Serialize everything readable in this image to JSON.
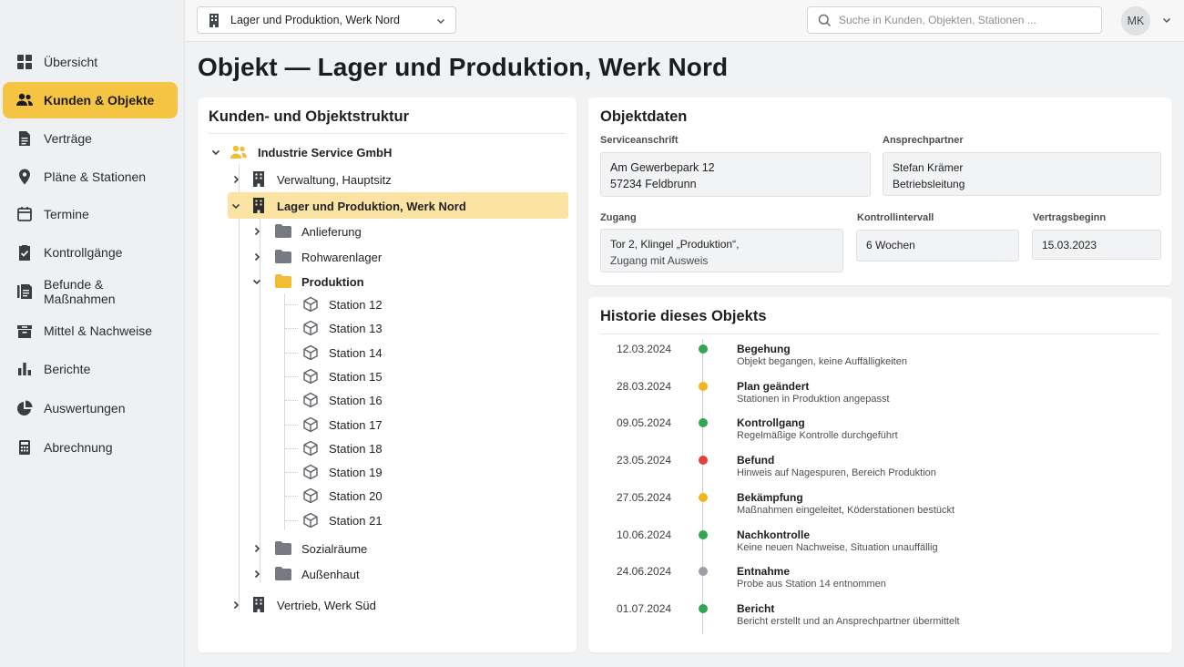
{
  "sidebar": {
    "items": [
      {
        "label": "Übersicht",
        "icon": "grid-icon"
      },
      {
        "label": "Kunden & Objekte",
        "icon": "users-icon",
        "active": true
      },
      {
        "label": "Verträge",
        "icon": "document-icon"
      },
      {
        "label": "Pläne & Stationen",
        "icon": "map-pin-icon"
      },
      {
        "label": "Termine",
        "icon": "calendar-icon"
      },
      {
        "label": "Kontrollgänge",
        "icon": "clipboard-check-icon"
      },
      {
        "label": "Befunde & Maßnahmen",
        "icon": "list-document-icon"
      },
      {
        "label": "Mittel & Nachweise",
        "icon": "box-icon"
      },
      {
        "label": "Berichte",
        "icon": "bar-chart-icon"
      },
      {
        "label": "Auswertungen",
        "icon": "pie-chart-icon"
      },
      {
        "label": "Abrechnung",
        "icon": "calculator-icon"
      }
    ]
  },
  "topbar": {
    "object_select": "Lager und Produktion, Werk Nord",
    "search_placeholder": "Suche in Kunden, Objekten, Stationen ...",
    "avatar_initials": "MK"
  },
  "page": {
    "title": "Objekt — Lager und Produktion, Werk Nord"
  },
  "tree": {
    "title": "Kunden- und Objektstruktur",
    "customer": "Industrie Service GmbH",
    "sites": [
      "Verwaltung, Hauptsitz",
      "Lager und Produktion, Werk Nord",
      "Vertrieb, Werk Süd"
    ],
    "areas": [
      "Anlieferung",
      "Rohwarenlager",
      "Produktion",
      "Sozialräume",
      "Außenhaut"
    ],
    "stations": [
      "Station 12",
      "Station 13",
      "Station 14",
      "Station 15",
      "Station 16",
      "Station 17",
      "Station 18",
      "Station 19",
      "Station 20",
      "Station 21"
    ]
  },
  "objektdaten": {
    "title": "Objektdaten",
    "serviceanschrift_label": "Serviceanschrift",
    "serviceanschrift_line1": "Am Gewerbepark 12",
    "serviceanschrift_line2": "57234 Feldbrunn",
    "ansprechpartner_label": "Ansprechpartner",
    "ansprechpartner_line1": "Stefan Krämer",
    "ansprechpartner_line2": "Betriebsleitung",
    "zugang_label": "Zugang",
    "zugang_line1": "Tor 2, Klingel „Produktion“,",
    "zugang_line2": "Zugang mit Ausweis",
    "kontrollintervall_label": "Kontrollintervall",
    "kontrollintervall_value": "6 Wochen",
    "vertragsbeginn_label": "Vertragsbeginn",
    "vertragsbeginn_value": "15.03.2023"
  },
  "historie": {
    "title": "Historie dieses Objekts",
    "entries": [
      {
        "date": "12.03.2024",
        "title": "Begehung",
        "desc": "Objekt begangen, keine Auffälligkeiten",
        "color": "#2fa84f"
      },
      {
        "date": "28.03.2024",
        "title": "Plan geändert",
        "desc": "Stationen in Produktion angepasst",
        "color": "#f1b51c"
      },
      {
        "date": "09.05.2024",
        "title": "Kontrollgang",
        "desc": "Regelmäßige Kontrolle durchgeführt",
        "color": "#2fa84f"
      },
      {
        "date": "23.05.2024",
        "title": "Befund",
        "desc": "Hinweis auf Nagespuren, Bereich Produktion",
        "color": "#e5403a"
      },
      {
        "date": "27.05.2024",
        "title": "Bekämpfung",
        "desc": "Maßnahmen eingeleitet, Köderstationen bestückt",
        "color": "#f1b51c"
      },
      {
        "date": "10.06.2024",
        "title": "Nachkontrolle",
        "desc": "Keine neuen Nachweise, Situation unauffällig",
        "color": "#2fa84f"
      },
      {
        "date": "24.06.2024",
        "title": "Entnahme",
        "desc": "Probe aus Station 14 entnommen",
        "color": "#9a9ea5"
      },
      {
        "date": "01.07.2024",
        "title": "Bericht",
        "desc": "Bericht erstellt und an Ansprechpartner übermittelt",
        "color": "#2fa84f"
      }
    ]
  }
}
